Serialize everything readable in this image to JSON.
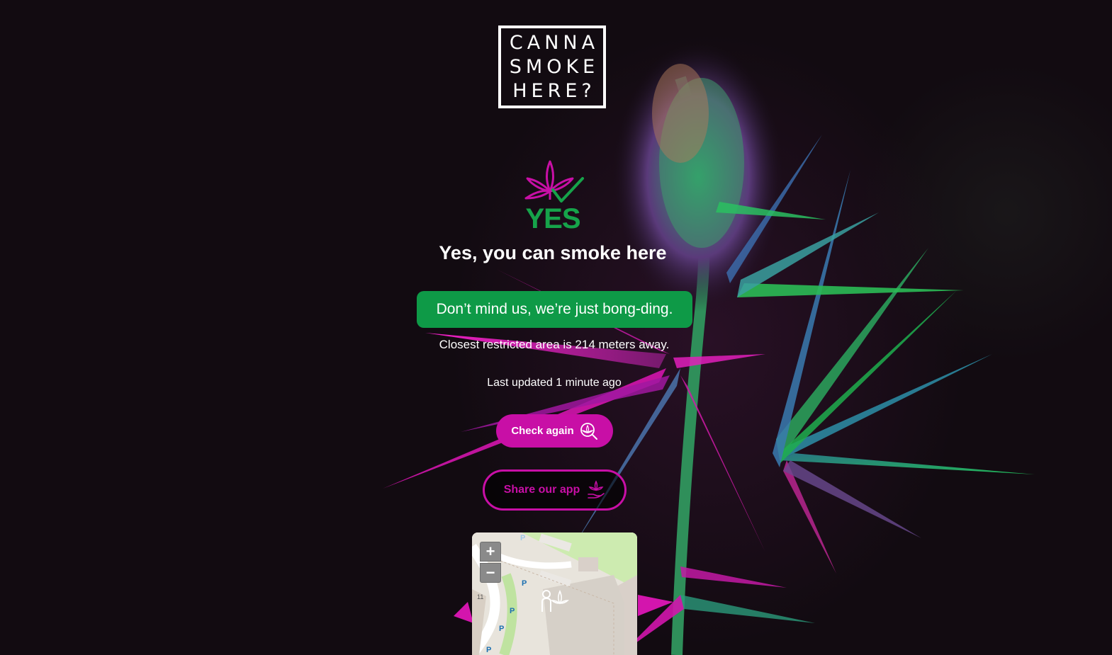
{
  "logo": {
    "lines": [
      "CANNA",
      "SMOKE",
      "HERE?"
    ]
  },
  "result": {
    "icon": "cannabis-check-icon",
    "badge_word": "YES",
    "headline": "Yes, you can smoke here",
    "banner": "Don’t mind us, we’re just bong-ding.",
    "distance_text": "Closest restricted area is 214 meters away.",
    "updated_text": "Last updated 1 minute ago"
  },
  "actions": {
    "check_again": "Check again",
    "check_again_icon": "cannabis-search-icon",
    "share": "Share our app",
    "share_icon": "cannabis-hand-icon"
  },
  "map": {
    "zoom_in": "+",
    "zoom_out": "−",
    "marker_icon": "person-cannabis-marker-icon",
    "parking_label": "P",
    "house_number": "11"
  },
  "colors": {
    "brand_magenta": "#c80fa6",
    "success_green": "#0e9a47",
    "yes_green": "#16a34a",
    "background": "#120b11"
  }
}
